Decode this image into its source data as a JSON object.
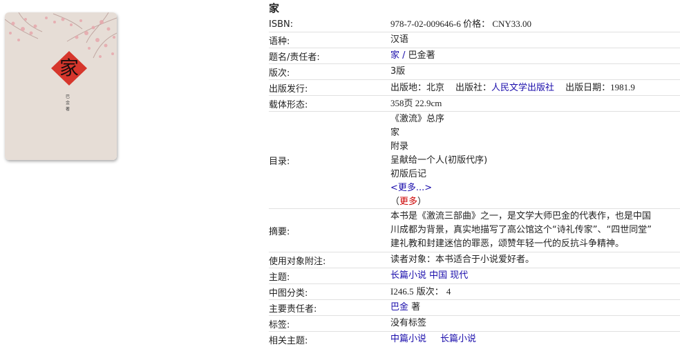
{
  "cover": {
    "title_char": "家",
    "author_small": "巴金著"
  },
  "book": {
    "title": "家"
  },
  "fields": {
    "isbn": {
      "label": "ISBN:",
      "value": "978-7-02-009646-6",
      "price_label": "价格：",
      "price": "CNY33.00"
    },
    "language": {
      "label": "语种:",
      "value": "汉语"
    },
    "title_resp": {
      "label": "题名/责任者:",
      "title_link": "家",
      "sep": " / ",
      "author": "巴金著"
    },
    "edition": {
      "label": "版次:",
      "value": "3版"
    },
    "publish": {
      "label": "出版发行:",
      "place_label": "出版地：",
      "place": "北京",
      "publisher_label": "出版社：",
      "publisher": "人民文学出版社",
      "date_label": "出版日期：",
      "date": "1981.9"
    },
    "physical": {
      "label": "载体形态:",
      "value": "358页 22.9cm"
    },
    "toc": {
      "label": "目录:",
      "lines": [
        "《激流》总序",
        "家",
        "附录",
        "呈献给一个人(初版代序)",
        "初版后记"
      ],
      "more_link": "<更多...>",
      "more_open": "（",
      "more_red": "更多",
      "more_close": "）"
    },
    "abstract": {
      "label": "摘要:",
      "lines": [
        "本书是《激流三部曲》之一，是文学大师巴金的代表作，也是中国",
        "川成都为背景，真实地描写了高公馆这个“诗礼传家”、“四世同堂”",
        "建礼教和封建迷信的罪恶，颂赞年轻一代的反抗斗争精神。"
      ]
    },
    "audience": {
      "label": "使用对象附注:",
      "value": "读者对象：本书适合于小说爱好者。"
    },
    "subject": {
      "label": "主题:",
      "value": "长篇小说 中国 现代"
    },
    "clc": {
      "label": "中图分类:",
      "value": "I246.5",
      "edition_label": "版次：",
      "edition": "4"
    },
    "responsible": {
      "label": "主要责任者:",
      "link": "巴金",
      "suffix": " 著"
    },
    "tags": {
      "label": "标签:",
      "value": "没有标签"
    },
    "related": {
      "label": "相关主题:",
      "links": [
        "中篇小说",
        "长篇小说"
      ]
    }
  },
  "colors": {
    "link": "#1a0dab",
    "more_red": "#cc0000",
    "cover_bg": "#e6ddd6",
    "cover_diamond": "#d6362c"
  }
}
